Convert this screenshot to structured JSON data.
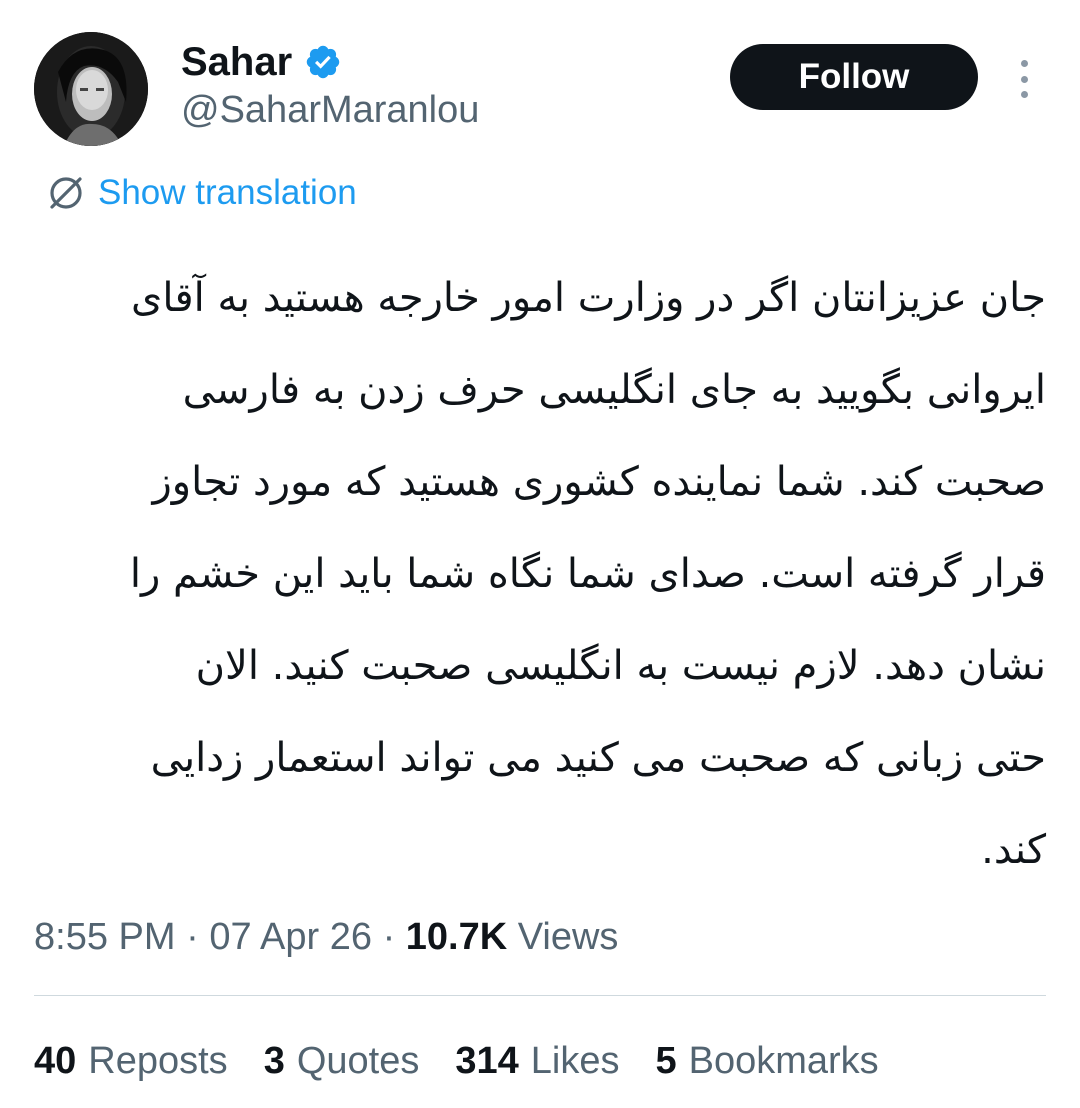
{
  "author": {
    "display_name": "Sahar",
    "handle": "@SaharMaranlou",
    "verified_icon": "verified-badge-icon",
    "verified_color": "#1d9bf0"
  },
  "actions": {
    "follow_label": "Follow",
    "more_icon": "more-options-icon"
  },
  "translation": {
    "label": "Show translation",
    "icon": "translate-icon",
    "color": "#1d9bf0"
  },
  "tweet": {
    "lines": [
      "جان عزیزانتان اگر در وزارت امور خارجه هستید به آقای",
      "ایروانی بگویید به جای انگلیسی حرف زدن به فارسی",
      "صحبت کند. شما نماینده کشوری هستید که مورد تجاوز",
      "قرار گرفته است. صدای شما نگاه شما باید این خشم را",
      "نشان دهد. لازم نیست به انگلیسی صحبت کنید. الان",
      "حتی زبانی که صحبت می کنید می تواند استعمار زدایی",
      "کند."
    ]
  },
  "meta": {
    "time": "8:55 PM",
    "separator": "·",
    "date": "07 Apr 26",
    "views_count": "10.7K",
    "views_label": "Views"
  },
  "stats": [
    {
      "count": "40",
      "label": "Reposts"
    },
    {
      "count": "3",
      "label": "Quotes"
    },
    {
      "count": "314",
      "label": "Likes"
    },
    {
      "count": "5",
      "label": "Bookmarks"
    }
  ]
}
